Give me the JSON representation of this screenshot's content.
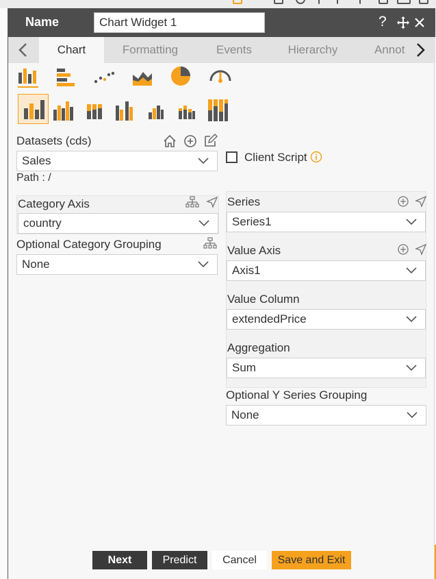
{
  "header": {
    "name_label": "Name",
    "name_value": "Chart Widget 1"
  },
  "tabs": [
    {
      "label": "Chart",
      "active": true
    },
    {
      "label": "Formatting",
      "active": false
    },
    {
      "label": "Events",
      "active": false
    },
    {
      "label": "Hierarchy",
      "active": false
    },
    {
      "label": "Annot",
      "active": false
    }
  ],
  "chart_types": [
    "column-chart",
    "bar-chart",
    "scatter-chart",
    "area-chart",
    "pie-chart",
    "gauge-chart"
  ],
  "chart_subtypes": [
    "column",
    "grouped-column",
    "stacked-column",
    "grouped-column-2",
    "column-small",
    "stacked-column-small",
    "full-stacked-column"
  ],
  "datasets": {
    "label": "Datasets (cds)",
    "value": "Sales",
    "path": "Path : /"
  },
  "client_script": {
    "label": "Client Script",
    "checked": false
  },
  "category_axis": {
    "label": "Category Axis",
    "value": "country"
  },
  "optional_category_grouping": {
    "label": "Optional Category Grouping",
    "value": "None"
  },
  "series": {
    "label": "Series",
    "value": "Series1"
  },
  "value_axis": {
    "label": "Value Axis",
    "value": "Axis1"
  },
  "value_column": {
    "label": "Value Column",
    "value": "extendedPrice"
  },
  "aggregation": {
    "label": "Aggregation",
    "value": "Sum"
  },
  "optional_y_series_grouping": {
    "label": "Optional Y Series Grouping",
    "value": "None"
  },
  "buttons": {
    "next": "Next",
    "predict": "Predict",
    "cancel": "Cancel",
    "save_exit": "Save and Exit"
  },
  "colors": {
    "accent": "#f5a11d",
    "dark": "#4d4d4d",
    "bar_dark": "#555555"
  }
}
